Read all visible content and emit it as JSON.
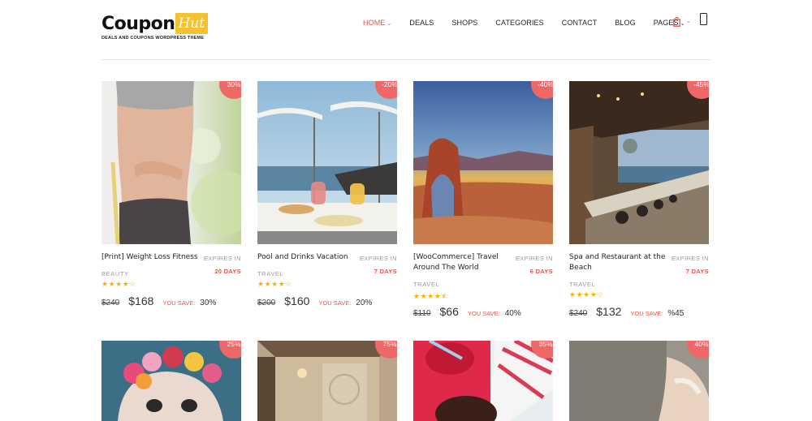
{
  "logo": {
    "name": "Coupon",
    "highlight": "Hut",
    "tagline": "DEALS AND COUPONS WORDPRESS THEME"
  },
  "nav": {
    "items": [
      {
        "label": "HOME",
        "caret": "⌄"
      },
      {
        "label": "DEALS"
      },
      {
        "label": "SHOPS"
      },
      {
        "label": "CATEGORIES"
      },
      {
        "label": "CONTACT"
      },
      {
        "label": "BLOG"
      },
      {
        "label": "PAGES",
        "caret": "⌄"
      }
    ],
    "cart_caret": "⌄",
    "accent": "#e5534b"
  },
  "common": {
    "expires_label": "EXPIRES IN",
    "save_label": "YOU SAVE:"
  },
  "deals": [
    {
      "title": "[Print] Weight Loss Fitness",
      "days": "20 DAYS",
      "category": "BEAUTY",
      "stars": "★★★★☆",
      "rating": 4,
      "old_price": "$240",
      "new_price": "$168",
      "save": "30%",
      "badge": "30%"
    },
    {
      "title": "Pool and Drinks Vacation",
      "days": "7 DAYS",
      "category": "TRAVEL",
      "stars": "★★★★☆",
      "rating": 4,
      "old_price": "$200",
      "new_price": "$160",
      "save": "20%",
      "badge": "-20%"
    },
    {
      "title": "[WooCommerce] Travel Around The World",
      "days": "6 DAYS",
      "category": "TRAVEL",
      "stars": "★★★★⯪",
      "rating": 4.5,
      "old_price": "$110",
      "new_price": "$66",
      "save": "40%",
      "badge": "-40%"
    },
    {
      "title": "Spa and Restaurant at the Beach",
      "days": "7 DAYS",
      "category": "TRAVEL",
      "stars": "★★★★☆",
      "rating": 4,
      "old_price": "$240",
      "new_price": "$132",
      "save": "%45",
      "badge": "-45%"
    },
    {
      "badge": "25%"
    },
    {
      "badge": "75%"
    },
    {
      "badge": "35%"
    },
    {
      "badge": "40%"
    }
  ],
  "colors": {
    "badge": "#ee6868",
    "star": "#f5b301",
    "logo_highlight": "#f5c130"
  }
}
